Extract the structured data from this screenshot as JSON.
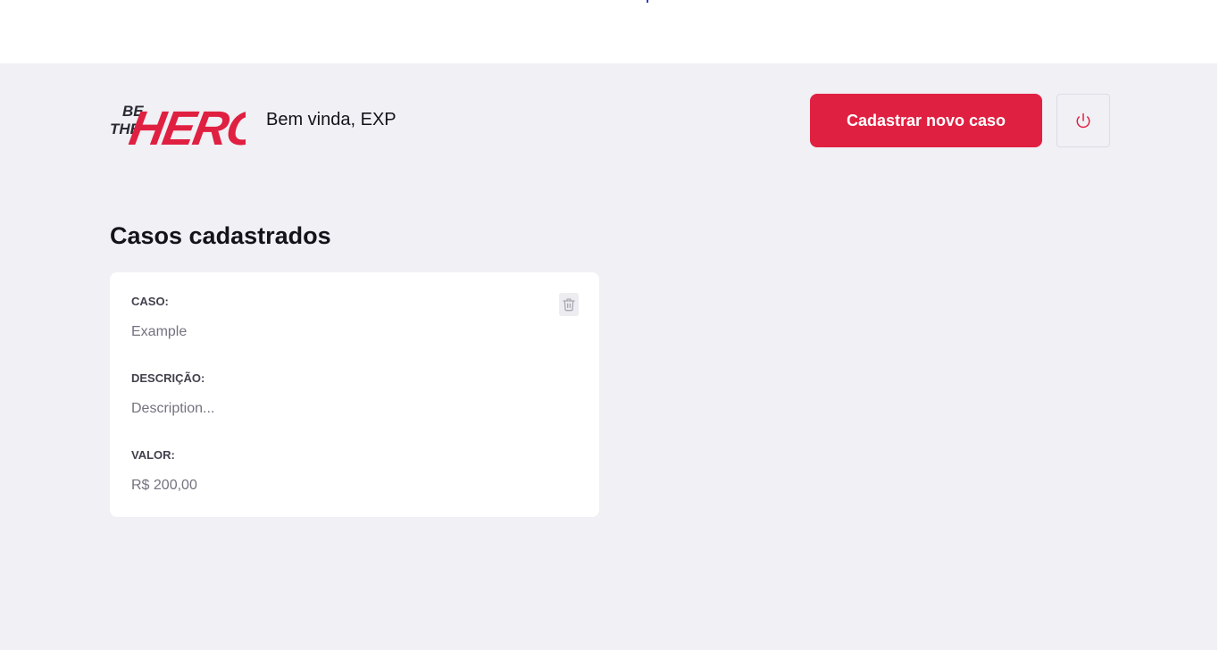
{
  "header": {
    "logo_text_small": [
      "BE",
      "THE"
    ],
    "logo_text_large": "HERO",
    "greeting": "Bem vinda, EXP",
    "new_case_label": "Cadastrar novo caso",
    "logout_icon": "power-icon"
  },
  "main": {
    "title": "Casos cadastrados",
    "cases": [
      {
        "case_label": "CASO:",
        "case_value": "Example",
        "description_label": "DESCRIÇÃO:",
        "description_value": "Description...",
        "value_label": "VALOR:",
        "value_value": "R$ 200,00",
        "delete_icon": "trash-icon"
      }
    ]
  },
  "colors": {
    "brand": "#e02041",
    "background": "#f0f0f5",
    "card": "#ffffff",
    "text": "#13131a",
    "label": "#41414d",
    "muted": "#737380"
  }
}
